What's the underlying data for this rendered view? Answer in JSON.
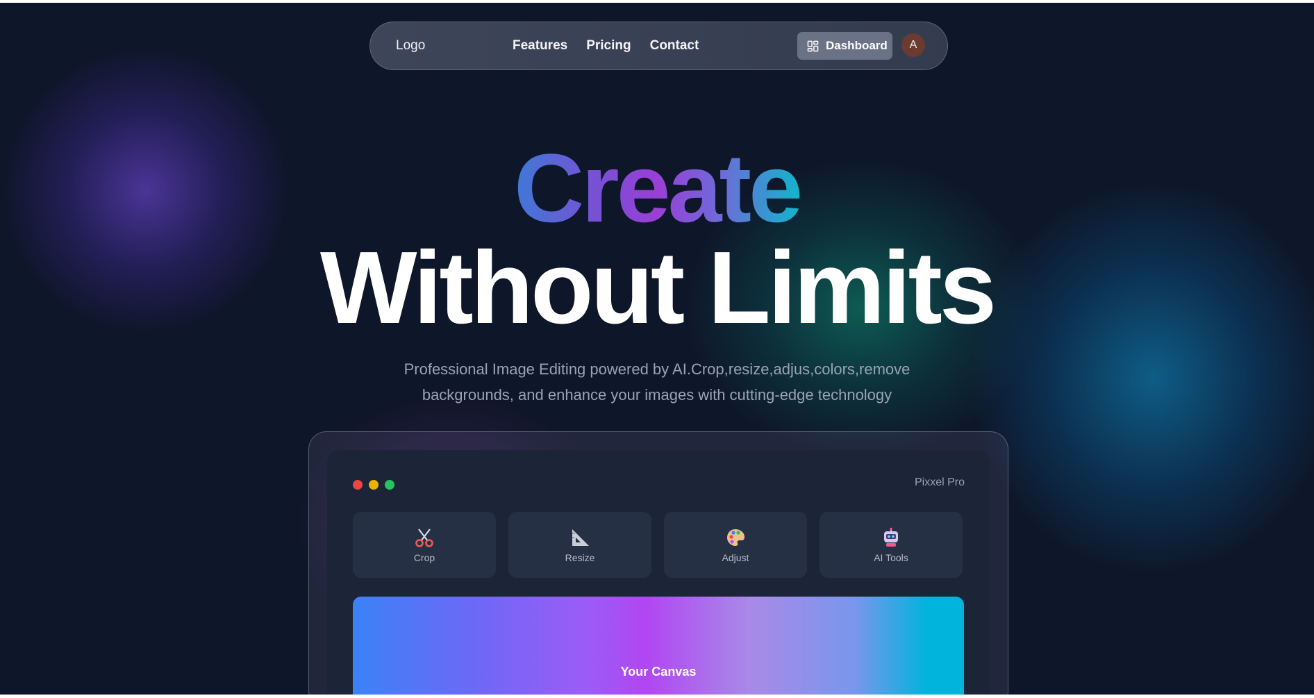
{
  "nav": {
    "logo": "Logo",
    "links": [
      "Features",
      "Pricing",
      "Contact"
    ],
    "dashboard_label": "Dashboard",
    "avatar_initial": "A"
  },
  "hero": {
    "title_gradient": "Create",
    "title_main": "Without Limits",
    "subtitle": "Professional Image Editing powered by AI.Crop,resize,adjus,colors,remove backgrounds, and enhance your images with cutting-edge technology"
  },
  "app": {
    "name": "Pixxel Pro",
    "tools": [
      {
        "label": "Crop",
        "icon": "scissors-icon"
      },
      {
        "label": "Resize",
        "icon": "ruler-triangle-icon"
      },
      {
        "label": "Adjust",
        "icon": "palette-icon"
      },
      {
        "label": "AI Tools",
        "icon": "robot-icon"
      }
    ],
    "canvas_label": "Your Canvas"
  },
  "colors": {
    "background": "#0e1629",
    "window": "#1c2538",
    "tool_card": "#263044",
    "traffic_red": "#ef4444",
    "traffic_yellow": "#eab308",
    "traffic_green": "#22c55e"
  }
}
